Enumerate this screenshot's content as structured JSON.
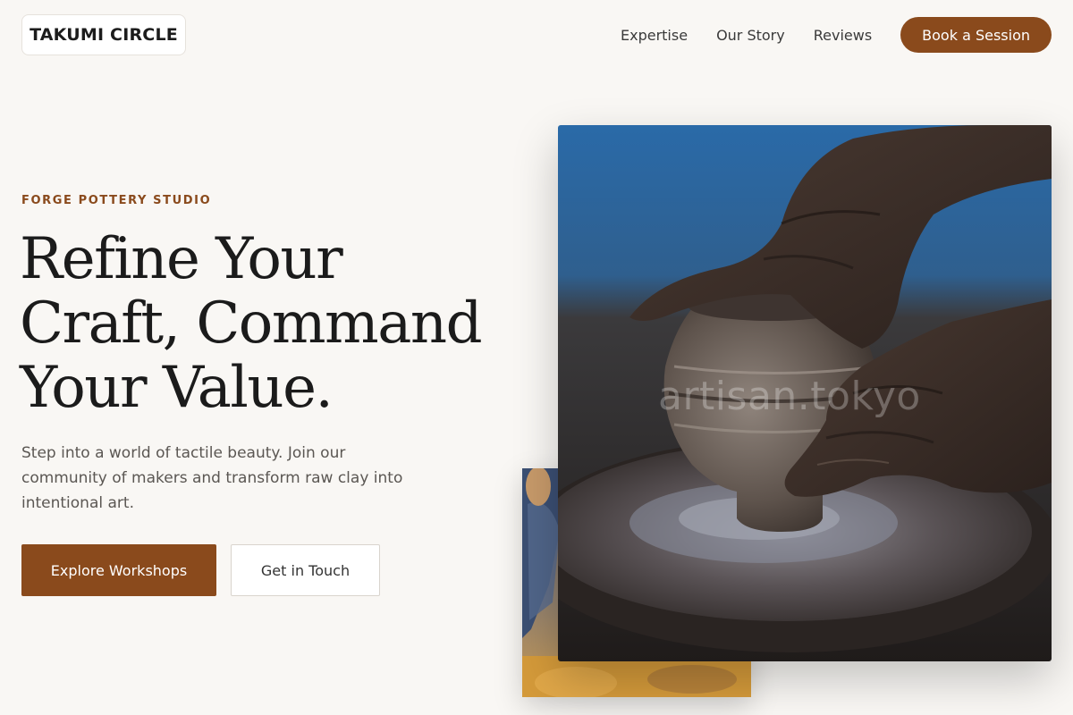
{
  "header": {
    "logo_text": "TAKUMI CIRCLE",
    "nav": [
      {
        "label": "Expertise"
      },
      {
        "label": "Our Story"
      },
      {
        "label": "Reviews"
      }
    ],
    "cta_label": "Book a Session"
  },
  "hero": {
    "eyebrow": "FORGE POTTERY STUDIO",
    "headline_lines": [
      "Refine Your",
      "Craft, Command",
      "Your Value."
    ],
    "subtext": "Step into a world of tactile beauty. Join our community of makers and transform raw clay into intentional art.",
    "primary_button": "Explore Workshops",
    "secondary_button": "Get in Touch"
  },
  "images": {
    "main_image": "potter-hands-wheel",
    "main_watermark": "artisan.tokyo",
    "secondary_image": "workshop-glazing"
  },
  "colors": {
    "accent": "#8a4a1c",
    "background": "#f9f7f4",
    "heading": "#1b1b1b",
    "body_text": "#5b5753"
  }
}
